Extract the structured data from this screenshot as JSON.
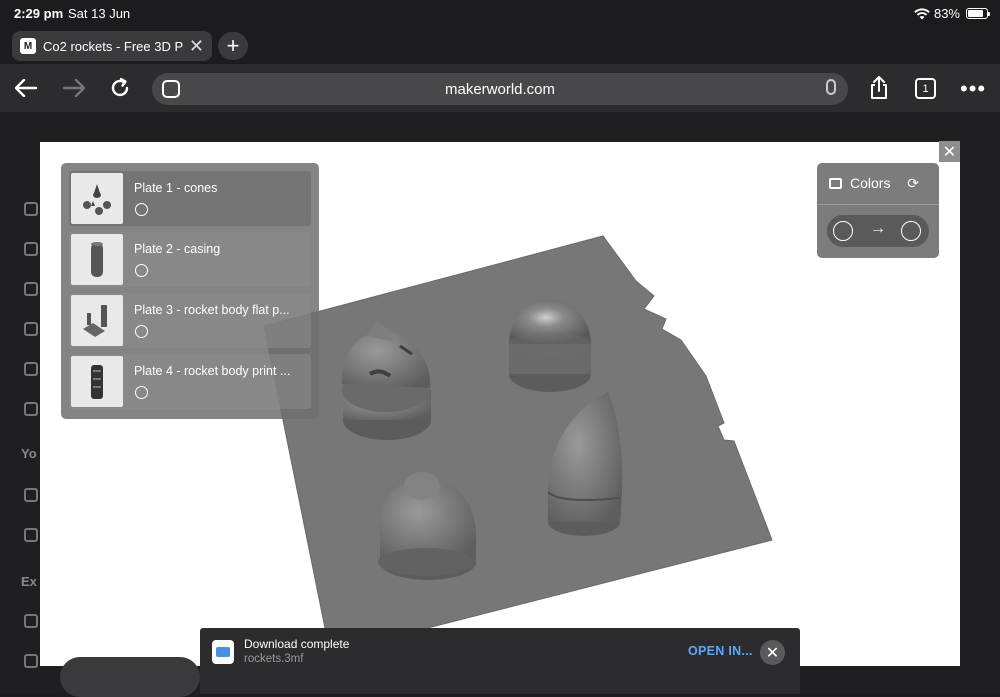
{
  "status_bar": {
    "time": "2:29 pm",
    "date": "Sat 13 Jun",
    "battery_percent": "83%",
    "battery_level": 0.83,
    "wifi_icon": "wifi-icon"
  },
  "tabs": [
    {
      "title": "Co2 rockets - Free 3D P",
      "favicon": "M",
      "close_icon": "close-icon"
    }
  ],
  "toolbar": {
    "back_icon": "arrow-left-icon",
    "forward_icon": "arrow-right-icon",
    "reload_icon": "reload-icon",
    "url": "makerworld.com",
    "share_icon": "share-icon",
    "tab_count": "1",
    "more_icon": "ellipsis-icon"
  },
  "sidebar": {
    "section_labels": [
      "Yo",
      "Ex"
    ]
  },
  "viewer": {
    "plates": [
      {
        "label": "Plate 1 - cones",
        "active": true
      },
      {
        "label": "Plate 2 - casing",
        "active": false
      },
      {
        "label": "Plate 3 - rocket body flat p...",
        "active": false
      },
      {
        "label": "Plate 4 - rocket body print ...",
        "active": false
      }
    ],
    "colors": {
      "title": "Colors",
      "brush_icon": "paint-roller-icon",
      "refresh_icon": "refresh-icon",
      "arrow": "→"
    },
    "model_color": "#6f6f6f",
    "plate_color": "#777777"
  },
  "download": {
    "title": "Download complete",
    "filename": "rockets.3mf",
    "open_label": "OPEN IN...",
    "close_icon": "close-icon"
  }
}
